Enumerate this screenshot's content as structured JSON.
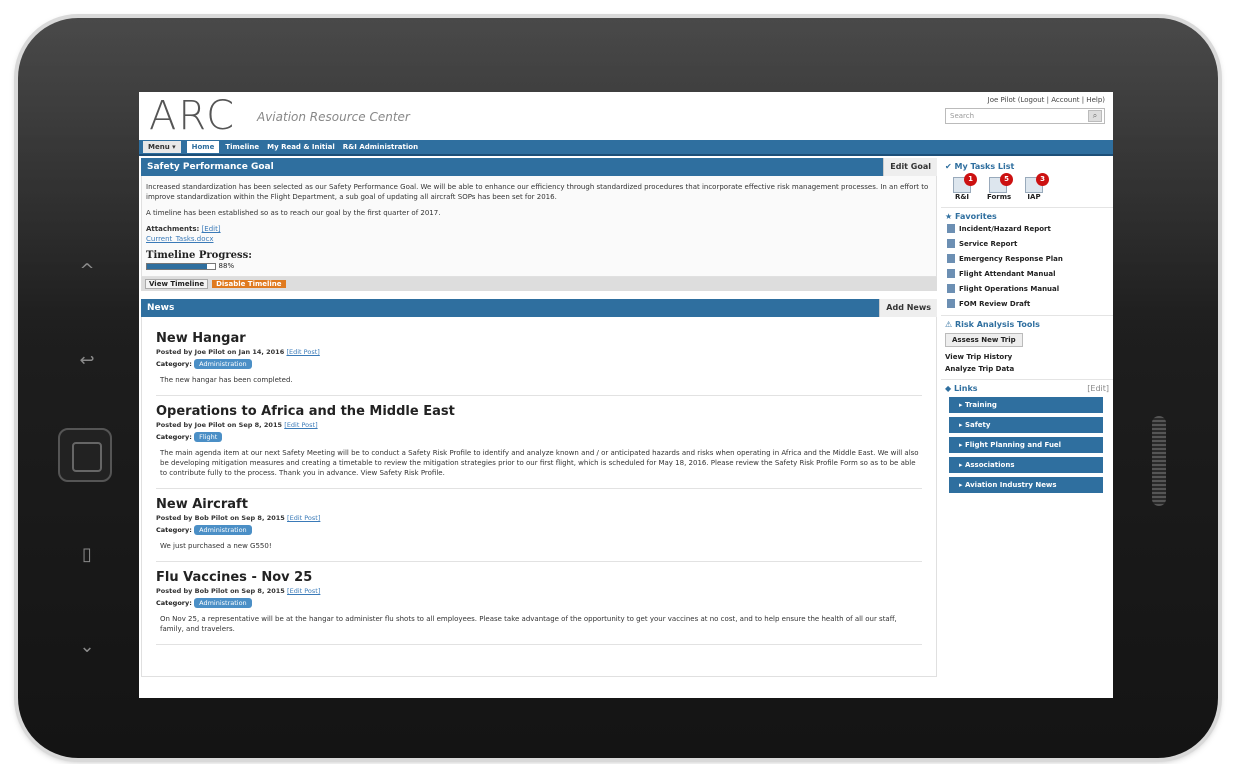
{
  "app": {
    "logo": "ARC",
    "subtitle": "Aviation Resource Center",
    "user_links": "Joe Pilot (Logout | Account | Help)",
    "search_placeholder": "Search"
  },
  "nav": {
    "menu": "Menu ▾",
    "items": [
      "Home",
      "Timeline",
      "My Read & Initial",
      "R&I Administration"
    ]
  },
  "goal": {
    "title": "Safety Performance Goal",
    "edit_label": "Edit Goal",
    "para1": "Increased standardization has been selected as our Safety Performance Goal. We will be able to enhance our efficiency through standardized procedures that incorporate effective risk management processes. In an effort to improve standardization within the Flight Department, a sub goal of updating all aircraft SOPs has been set for 2016.",
    "para2": "A timeline has been established so as to reach our goal by the first quarter of 2017.",
    "attachments_label": "Attachments:",
    "attachments_edit": "[Edit]",
    "attachment_file": "Current_Tasks.docx",
    "timeline_label": "Timeline Progress:",
    "progress": 88,
    "progress_text": "88%",
    "view_timeline": "View Timeline",
    "disable_timeline": "Disable Timeline"
  },
  "news": {
    "title": "News",
    "add_label": "Add News",
    "category_label": "Category:",
    "posts": [
      {
        "title": "New Hangar",
        "meta": "Posted by Joe Pilot on Jan 14, 2016",
        "edit": "[Edit Post]",
        "category": "Administration",
        "text": "The new hangar has been completed."
      },
      {
        "title": "Operations to Africa and the Middle East",
        "meta": "Posted by Joe Pilot on Sep 8, 2015",
        "edit": "[Edit Post]",
        "category": "Flight",
        "text": "The main agenda item at our next Safety Meeting will be to conduct a Safety Risk Profile to identify and analyze known and / or anticipated hazards and risks when operating in Africa and the Middle East. We will also be developing mitigation measures and creating a timetable to review the mitigation strategies prior to our first flight, which is scheduled for May 18, 2016. Please review the Safety Risk Profile Form so as to be able to contribute fully to the process. Thank you in advance. View Safety Risk Profile."
      },
      {
        "title": "New Aircraft",
        "meta": "Posted by Bob Pilot on Sep 8, 2015",
        "edit": "[Edit Post]",
        "category": "Administration",
        "text": "We just purchased a new G550!"
      },
      {
        "title": "Flu Vaccines - Nov 25",
        "meta": "Posted by Bob Pilot on Sep 8, 2015",
        "edit": "[Edit Post]",
        "category": "Administration",
        "text": "On Nov 25, a representative will be at the hangar to administer flu shots to all employees. Please take advantage of the opportunity to get your vaccines at no cost, and to help ensure the health of all our staff, family, and travelers."
      }
    ]
  },
  "sidebar": {
    "tasks_title": "My Tasks List",
    "tasks": [
      {
        "label": "R&I",
        "count": "1"
      },
      {
        "label": "Forms",
        "count": "5"
      },
      {
        "label": "IAP",
        "count": "3"
      }
    ],
    "favorites_title": "Favorites",
    "favorites": [
      "Incident/Hazard Report",
      "Service Report",
      "Emergency Response Plan",
      "Flight Attendant Manual",
      "Flight Operations Manual",
      "FOM Review Draft"
    ],
    "risk_title": "Risk Analysis Tools",
    "risk_button": "Assess New Trip",
    "risk_links": [
      "View Trip History",
      "Analyze Trip Data"
    ],
    "links_title": "Links",
    "links_edit": "[Edit]",
    "links": [
      "Training",
      "Safety",
      "Flight Planning and Fuel",
      "Associations",
      "Aviation Industry News"
    ]
  }
}
